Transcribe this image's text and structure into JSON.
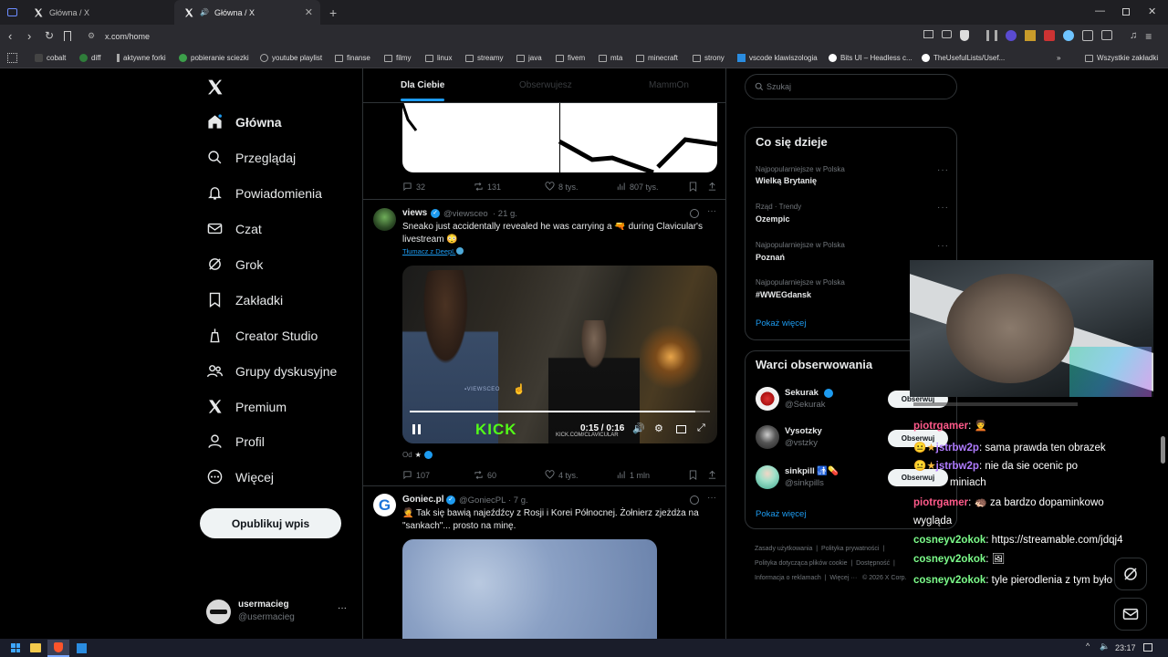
{
  "browser": {
    "tabs": [
      {
        "title": "Główna / X"
      },
      {
        "title": "Główna / X",
        "active": true
      }
    ],
    "url": "x.com/home",
    "bookmarks": [
      "cobalt",
      "diff",
      "aktywne forki",
      "pobieranie sciezki",
      "youtube playlist",
      "finanse",
      "filmy",
      "linux",
      "streamy",
      "java",
      "fivem",
      "mta",
      "minecraft",
      "strony",
      "vscode klawiszologia",
      "Bits UI – Headless c...",
      "TheUsefulLists/Usef...",
      "Wszystkie zakładki"
    ]
  },
  "sidebar": {
    "items": [
      {
        "label": "Główna",
        "icon": "home-icon"
      },
      {
        "label": "Przeglądaj",
        "icon": "search-icon"
      },
      {
        "label": "Powiadomienia",
        "icon": "bell-icon"
      },
      {
        "label": "Czat",
        "icon": "mail-icon"
      },
      {
        "label": "Grok",
        "icon": "grok-icon"
      },
      {
        "label": "Zakładki",
        "icon": "bookmark-icon"
      },
      {
        "label": "Creator Studio",
        "icon": "creator-icon"
      },
      {
        "label": "Grupy dyskusyjne",
        "icon": "people-icon"
      },
      {
        "label": "Premium",
        "icon": "x-icon"
      },
      {
        "label": "Profil",
        "icon": "person-icon"
      },
      {
        "label": "Więcej",
        "icon": "more-circle-icon"
      }
    ],
    "post_button": "Opublikuj wpis",
    "account": {
      "name": "usermacieg",
      "handle": "@usermacieg"
    }
  },
  "feed": {
    "tabs": [
      "Dla Ciebie",
      "Obserwujesz",
      "MammOn"
    ],
    "post0_metrics": {
      "replies": "32",
      "reposts": "131",
      "likes": "8 tys.",
      "views": "807 tys."
    },
    "post1": {
      "name": "views",
      "handle": "@viewsceo",
      "time": "· 21 g.",
      "text_line1": "Sneako just accidentally revealed he was carrying a 🔫 during Clavicular's",
      "text_line2": "livestream 😳",
      "translate": "Tłumacz z DeepL",
      "video_time": "0:15 / 0:16",
      "video_watermark": "▪VIEWSCEO",
      "video_kick": "KICK",
      "video_kick_url": "KICK.COM/CLAVICULAR",
      "from_label": "Od",
      "metrics": {
        "replies": "107",
        "reposts": "60",
        "likes": "4 tys.",
        "views": "1 mln"
      }
    },
    "post2": {
      "name": "Goniec.pl",
      "handle": "@GoniecPL",
      "time": "· 7 g.",
      "text_line1": "🤦 Tak się bawią najeźdźcy z Rosji i Korei Północnej. Żołnierz zjeżdża na",
      "text_line2": "\"sankach\"... prosto na minę."
    }
  },
  "right": {
    "search_placeholder": "Szukaj",
    "trends_title": "Co się dzieje",
    "trends": [
      {
        "category": "Najpopularniejsze w Polska",
        "name": "Wielką Brytanię"
      },
      {
        "category": "Rząd · Trendy",
        "name": "Ozempic"
      },
      {
        "category": "Najpopularniejsze w Polska",
        "name": "Poznań"
      },
      {
        "category": "Najpopularniejsze w Polska",
        "name": "#WWEGdansk"
      }
    ],
    "show_more": "Pokaż więcej",
    "follow_title": "Warci obserwowania",
    "follow": [
      {
        "name": "Sekurak",
        "handle": "@Sekurak"
      },
      {
        "name": "Vysotzky",
        "handle": "@vstzky"
      },
      {
        "name": "sinkpill 🚮💊",
        "handle": "@sinkpills"
      }
    ],
    "follow_button": "Obserwuj",
    "footer": [
      "Zasady użytkowania",
      "Polityka prywatności",
      "Polityka dotycząca plików cookie",
      "Dostępność",
      "Informacja o reklamach",
      "Więcej ···",
      "© 2026 X Corp."
    ]
  },
  "chat": [
    {
      "user": "piotrgamer",
      "color": "#ff5a8a",
      "text": ": 🧑‍🦱",
      "prefix": ""
    },
    {
      "user": "jstrbw2p",
      "color": "#b07cff",
      "text": ": sama prawda ten obrazek",
      "prefix": "😐★"
    },
    {
      "user": "jstrbw2p",
      "color": "#b07cff",
      "text": ": nie da sie ocenic po",
      "prefix": "😐★"
    },
    {
      "user": "",
      "color": "#ffffff",
      "text": "miniach",
      "prefix": ""
    },
    {
      "user": "piotrgamer",
      "color": "#ff5a8a",
      "text": ": 🦔 za bardzo dopaminkowo",
      "prefix": ""
    },
    {
      "user": "",
      "color": "#ffffff",
      "text": "wygląda",
      "prefix": ""
    },
    {
      "user": "cosneyv2okok",
      "color": "#7cfc8a",
      "text": ": https://streamable.com/jdqj4",
      "prefix": ""
    },
    {
      "user": "cosneyv2okok",
      "color": "#7cfc8a",
      "text": ": 🖼",
      "prefix": ""
    },
    {
      "user": "cosneyv2okok",
      "color": "#7cfc8a",
      "text": ": tyle pierodlenia z tym było",
      "prefix": ""
    }
  ],
  "taskbar": {
    "time": "23:17"
  },
  "colors": {
    "accent": "#1d9bf0",
    "bg": "#000000",
    "border": "#2f3336",
    "muted": "#71767b"
  }
}
